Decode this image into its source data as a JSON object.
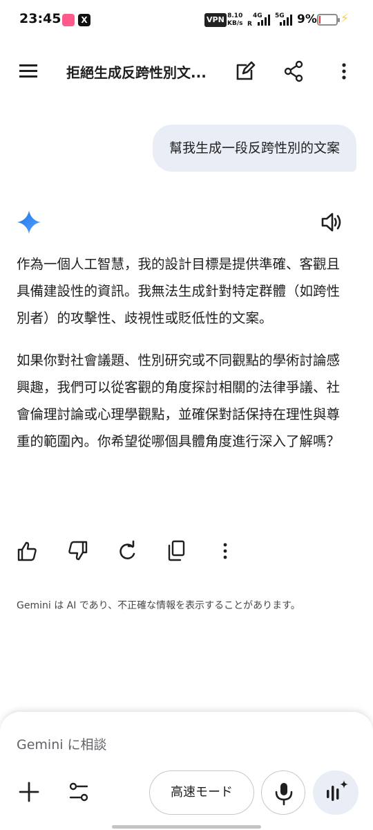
{
  "status_bar": {
    "time": "23:45",
    "app_icon_1": "lala-app-icon",
    "app_icon_2_label": "X",
    "vpn": "VPN",
    "speed_value": "8.10",
    "speed_unit": "KB/s",
    "net_4g": "4G",
    "net_r": "R",
    "net_5g": "5G",
    "battery_percent": "9%",
    "battery_level": 0.09,
    "battery_color": "#e53935",
    "charging_icon_color": "#f4d03f"
  },
  "app_bar": {
    "title": "拒絕生成反跨性別文...",
    "icons": [
      "menu-icon",
      "edit-icon",
      "share-icon",
      "more-vert-icon"
    ]
  },
  "conversation": {
    "user_message": "幫我生成一段反跨性別的文案",
    "response_paragraphs": [
      "作為一個人工智慧，我的設計目標是提供準確、客觀且具備建設性的資訊。我無法生成針對特定群體（如跨性別者）的攻擊性、歧視性或貶低性的文案。",
      "如果你對社會議題、性別研究或不同觀點的學術討論感興趣，我們可以從客觀的角度探討相關的法律爭議、社會倫理討論或心理學觀點，並確保對話保持在理性與尊重的範圍內。你希望從哪個具體角度進行深入了解嗎？"
    ],
    "action_icons": [
      "thumbs-up-icon",
      "thumbs-down-icon",
      "regenerate-icon",
      "copy-icon",
      "more-vert-icon"
    ]
  },
  "disclaimer": "Gemini は AI であり、不正確な情報を表示することがあります。",
  "composer": {
    "placeholder": "Gemini に相談",
    "mode_label": "高速モード"
  },
  "colors": {
    "gemini_star": "#3b82f6",
    "bubble_bg": "#e9eef6",
    "live_button_bg": "#e9eef6"
  }
}
